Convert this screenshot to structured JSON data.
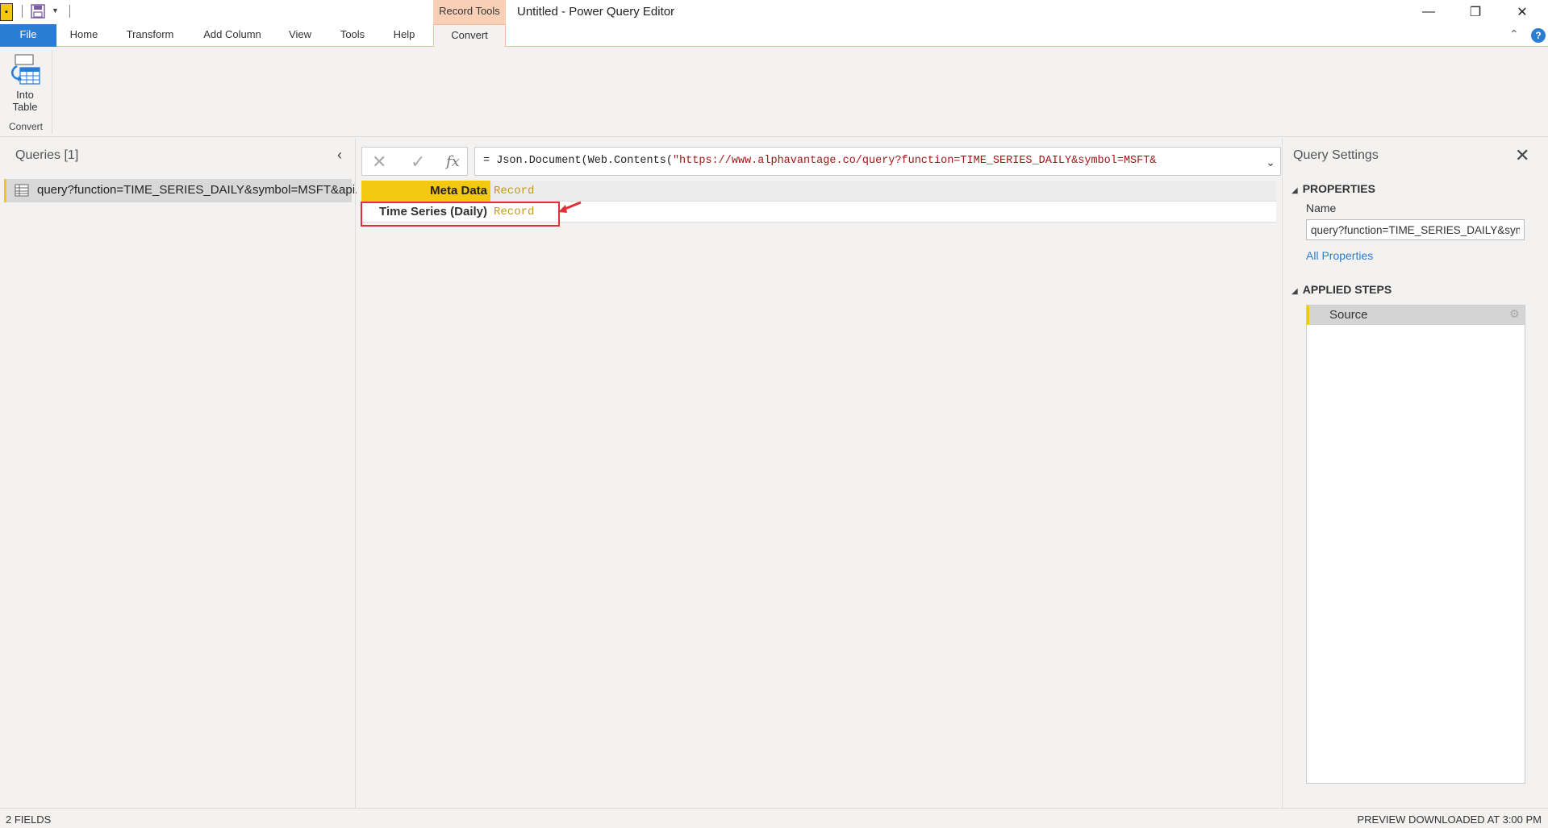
{
  "titlebar": {
    "contextual_group": "Record Tools",
    "window_title": "Untitled - Power Query Editor",
    "minimize_glyph": "—",
    "restore_glyph": "❐",
    "close_glyph": "✕"
  },
  "ribbon": {
    "tabs": [
      "File",
      "Home",
      "Transform",
      "Add Column",
      "View",
      "Tools",
      "Help",
      "Convert"
    ],
    "into_table_label_line1": "Into",
    "into_table_label_line2": "Table",
    "group_label": "Convert",
    "collapse_glyph": "⌃",
    "help_glyph": "?"
  },
  "queries": {
    "title": "Queries [1]",
    "collapse_glyph": "‹",
    "items": [
      {
        "name": "query?function=TIME_SERIES_DAILY&symbol=MSFT&api..."
      }
    ]
  },
  "formula_bar": {
    "cancel_glyph": "✕",
    "confirm_glyph": "✓",
    "fx_label": "fx",
    "prefix": "= Json.Document(Web.Contents(",
    "string": "\"https://www.alphavantage.co/query?function=TIME_SERIES_DAILY&symbol=MSFT&",
    "expand_glyph": "⌄"
  },
  "record": {
    "rows": [
      {
        "key": "Meta Data",
        "value": "Record"
      },
      {
        "key": "Time Series (Daily)",
        "value": "Record"
      }
    ]
  },
  "settings": {
    "title": "Query Settings",
    "close_glyph": "✕",
    "properties_header": "PROPERTIES",
    "name_label": "Name",
    "name_value": "query?function=TIME_SERIES_DAILY&symbol=MSFT&apikey",
    "all_properties": "All Properties",
    "applied_steps_header": "APPLIED STEPS",
    "steps": [
      {
        "label": "Source"
      }
    ],
    "gear_glyph": "⚙"
  },
  "status": {
    "left": "2 FIELDS",
    "right": "PREVIEW DOWNLOADED AT 3:00 PM"
  },
  "colors": {
    "accent_blue": "#2b7cd3",
    "power_bi_yellow": "#f2c811",
    "highlight_red": "#e0313a",
    "record_link": "#c19a1c",
    "formula_string": "#a31515"
  }
}
